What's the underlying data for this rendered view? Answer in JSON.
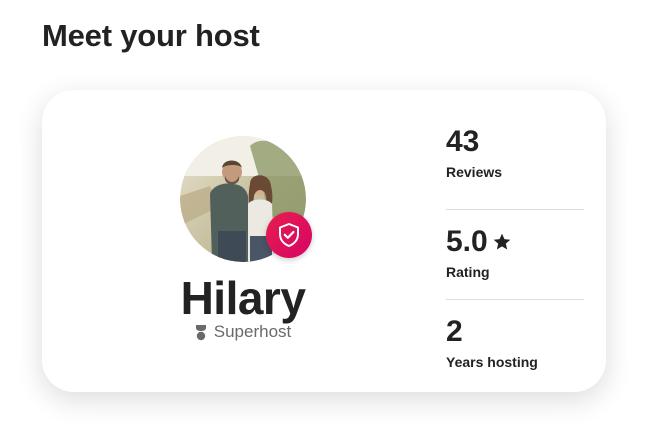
{
  "section": {
    "title": "Meet your host"
  },
  "host": {
    "name": "Hilary",
    "badge_label": "Superhost",
    "avatar_icon": "host-avatar-photo",
    "verified_icon": "shield-check-icon"
  },
  "stats": [
    {
      "value": "43",
      "label": "Reviews"
    },
    {
      "value": "5.0",
      "label": "Rating",
      "icon": "star-icon"
    },
    {
      "value": "2",
      "label": "Years hosting"
    }
  ],
  "colors": {
    "badge_gradient_start": "#e61e4d",
    "badge_gradient_end": "#d70466",
    "text_primary": "#222222",
    "text_secondary": "#6a6a6a",
    "divider": "#dddddd"
  }
}
